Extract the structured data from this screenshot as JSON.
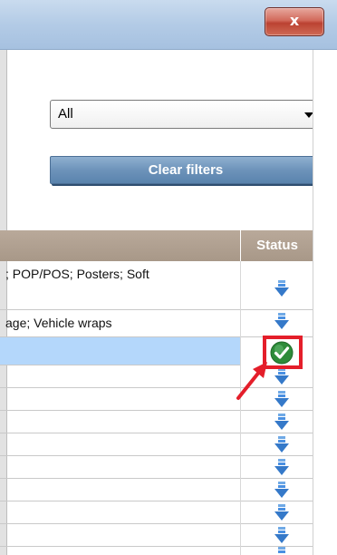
{
  "window": {
    "close_label": "x"
  },
  "filters": {
    "select_value": "All",
    "clear_label": "Clear filters"
  },
  "table": {
    "status_header": "Status",
    "rows": [
      {
        "text": "; POP/POS; Posters; Soft",
        "status": "download"
      },
      {
        "text": "age; Vehicle wraps",
        "status": "download"
      },
      {
        "text": "",
        "status": "installed",
        "selected": true
      },
      {
        "text": "",
        "status": "download"
      },
      {
        "text": "",
        "status": "download"
      },
      {
        "text": "",
        "status": "download"
      },
      {
        "text": "",
        "status": "download"
      },
      {
        "text": "",
        "status": "download"
      },
      {
        "text": "",
        "status": "download"
      },
      {
        "text": "",
        "status": "download"
      },
      {
        "text": "",
        "status": "download"
      }
    ]
  },
  "colors": {
    "highlight_box": "#e41e2a",
    "annotation_arrow": "#e41e2a",
    "selected_row": "#b4d7fb",
    "download_icon": "#4a90e2",
    "check_icon": "#2e8b3a"
  },
  "icons": {
    "download": "download-arrow-icon",
    "installed": "checkmark-icon",
    "close": "close-icon"
  }
}
